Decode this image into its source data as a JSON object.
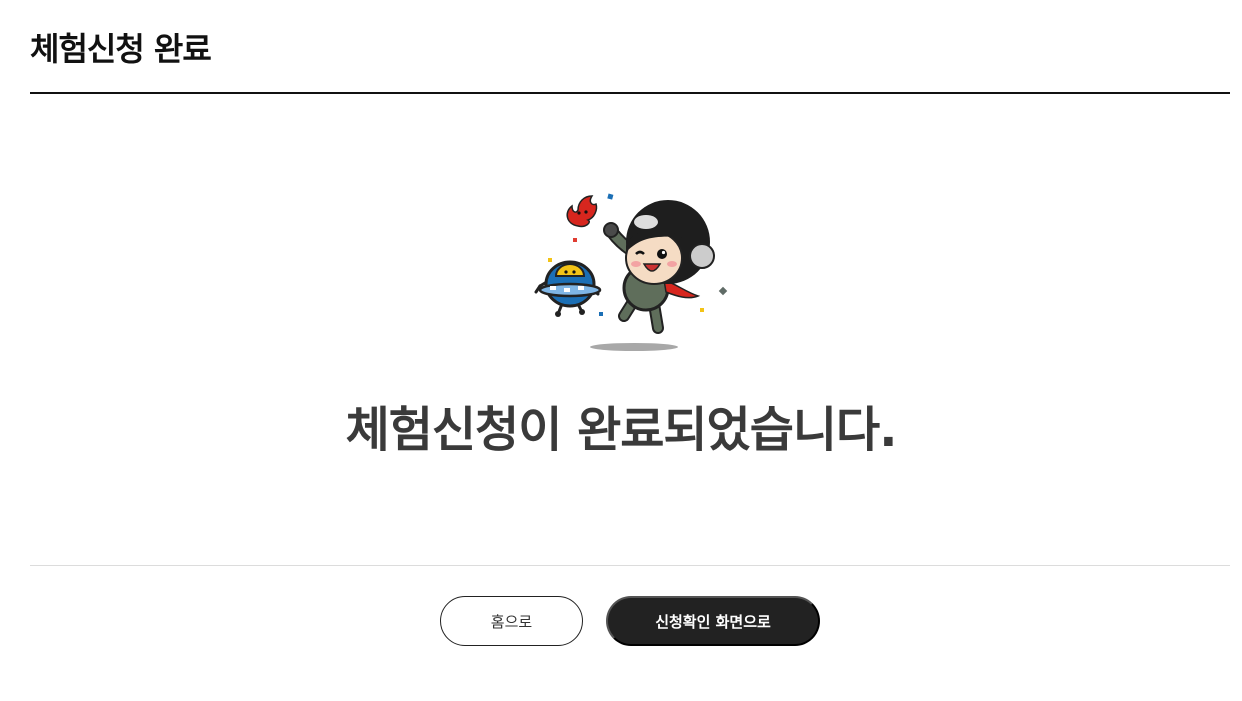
{
  "header": {
    "title": "체험신청 완료"
  },
  "main": {
    "message": "체험신청이 완료되었습니다."
  },
  "actions": {
    "home_label": "홈으로",
    "confirm_label": "신청확인 화면으로"
  },
  "colors": {
    "button_dark": "#222222",
    "message_text": "#3a3a3a",
    "divider": "#dcdcdc"
  }
}
